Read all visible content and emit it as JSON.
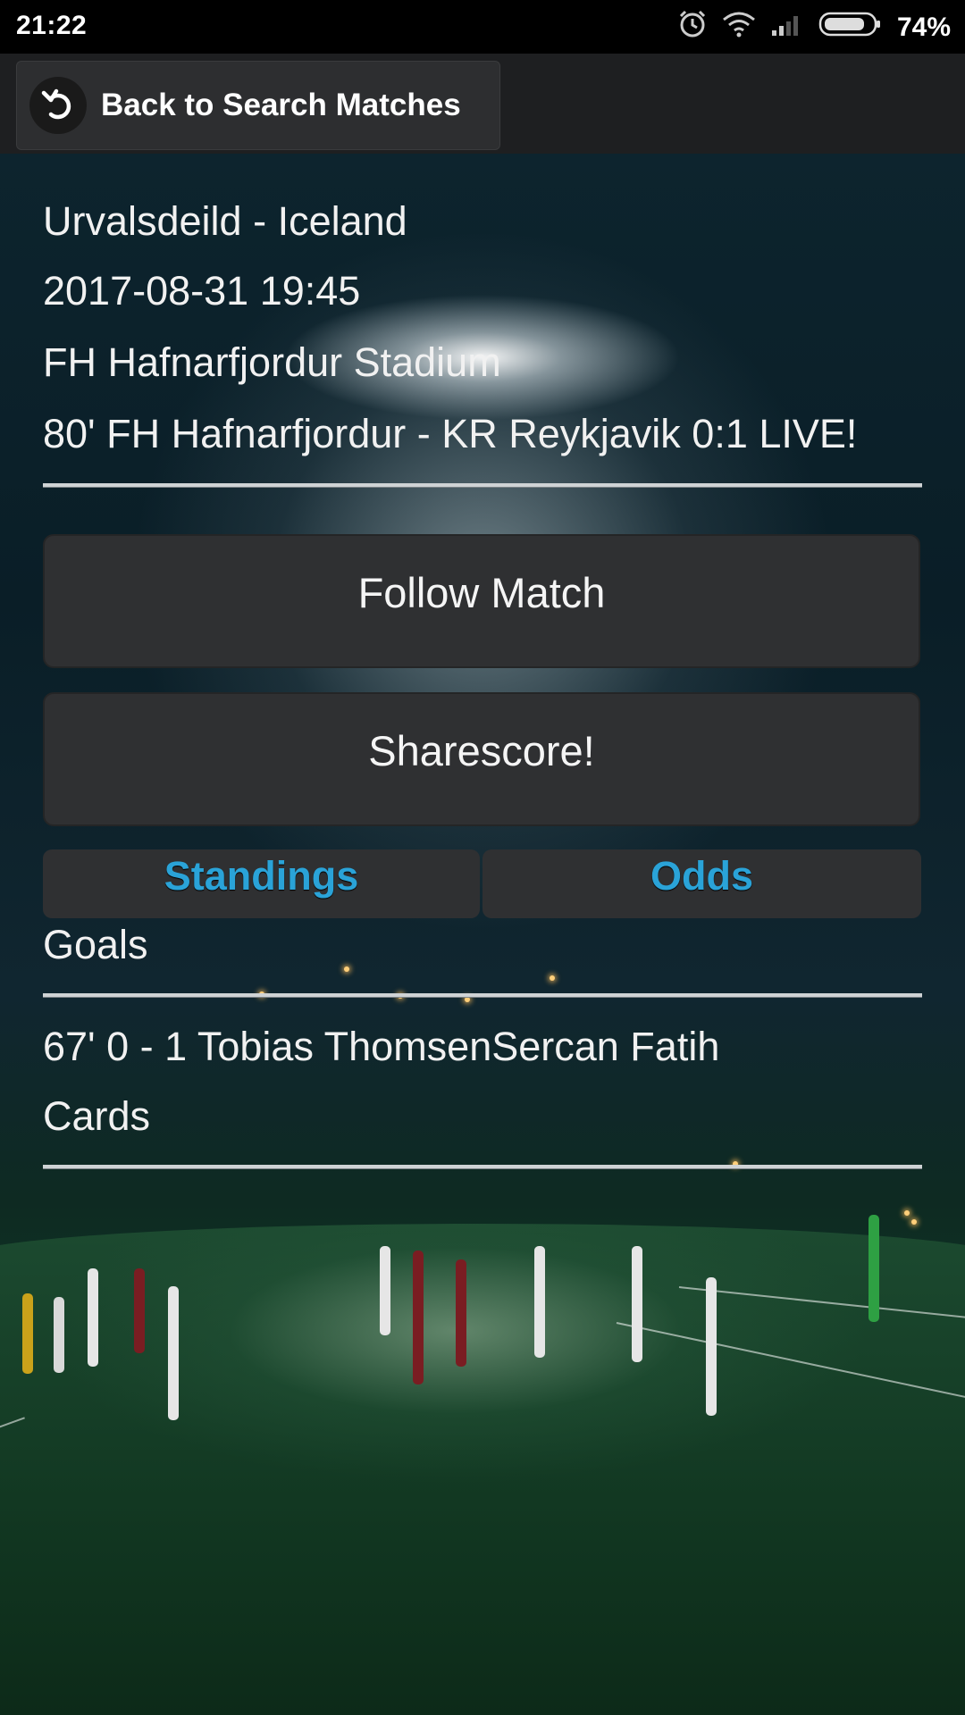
{
  "status_bar": {
    "time": "21:22",
    "battery": "74%",
    "icons": [
      "alarm-icon",
      "wifi-icon",
      "signal-icon",
      "battery-icon"
    ]
  },
  "toolbar": {
    "back_label": "Back to Search Matches",
    "back_icon": "undo-arrow-icon"
  },
  "match": {
    "league": "Urvalsdeild - Iceland",
    "datetime": "2017-08-31 19:45",
    "venue": "FH Hafnarfjordur Stadium",
    "live_line": "80' FH Hafnarfjordur - KR Reykjavik 0:1 LIVE!"
  },
  "actions": {
    "follow_label": "Follow Match",
    "share_label": "Sharescore!"
  },
  "tabs": [
    {
      "label": "Standings"
    },
    {
      "label": "Odds"
    }
  ],
  "goals": {
    "heading": "Goals",
    "events": [
      "67' 0 - 1 Tobias ThomsenSercan Fatih"
    ]
  },
  "cards": {
    "heading": "Cards"
  },
  "colors": {
    "accent_tab_text": "#2aa3d8",
    "button_bg": "#2f3032",
    "status_bar_bg": "#000000",
    "toolbar_bg": "#1e1f21"
  }
}
